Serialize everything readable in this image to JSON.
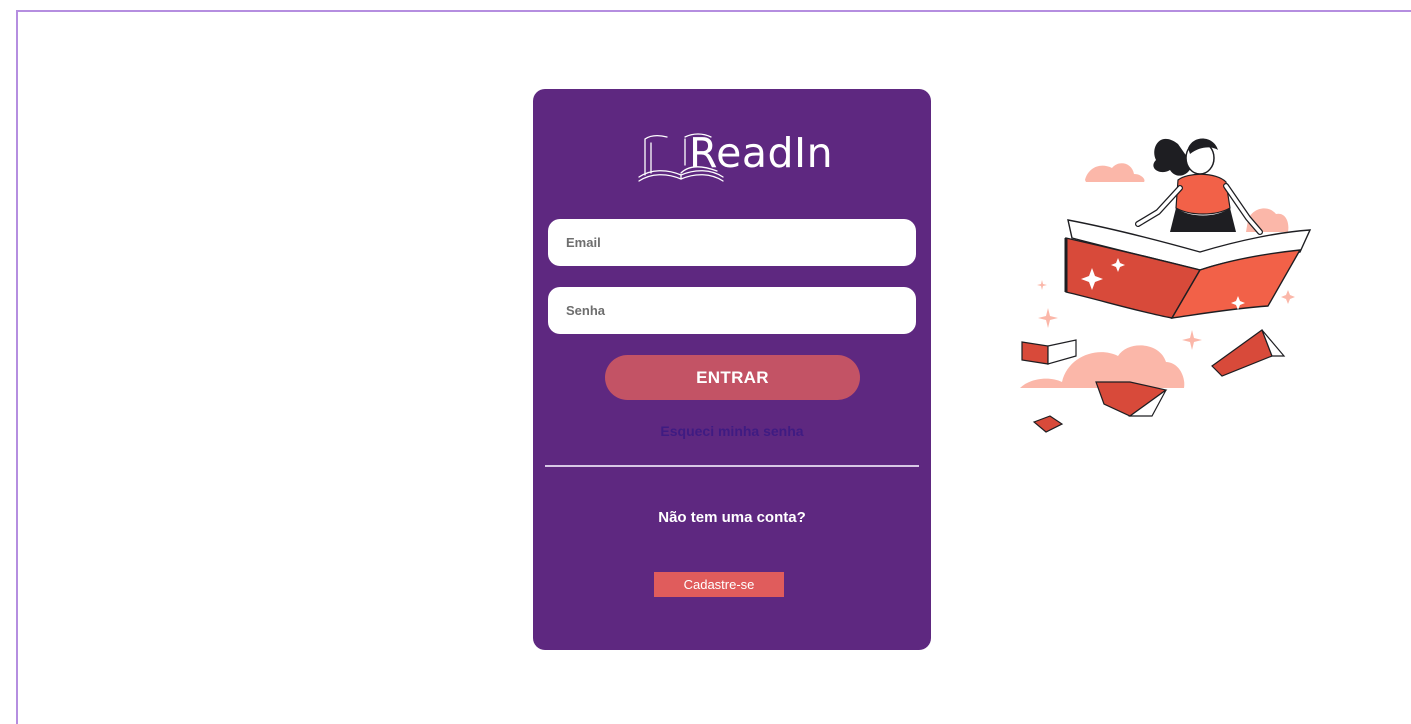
{
  "app": {
    "logo_text": "ReadIn"
  },
  "login": {
    "email_placeholder": "Email",
    "password_placeholder": "Senha",
    "submit_label": "ENTRAR",
    "forgot_password": "Esqueci minha senha",
    "no_account_text": "Não tem uma conta?",
    "signup_label": "Cadastre-se"
  },
  "icons": {
    "logo": "open-book-icon",
    "illustration": "woman-reading-flying-book-illustration"
  },
  "colors": {
    "card_background": "#5e2880",
    "primary_button": "#c35365",
    "signup_button": "#e05c5c",
    "link": "#3f1b82",
    "frame_border": "#b58ee0"
  }
}
